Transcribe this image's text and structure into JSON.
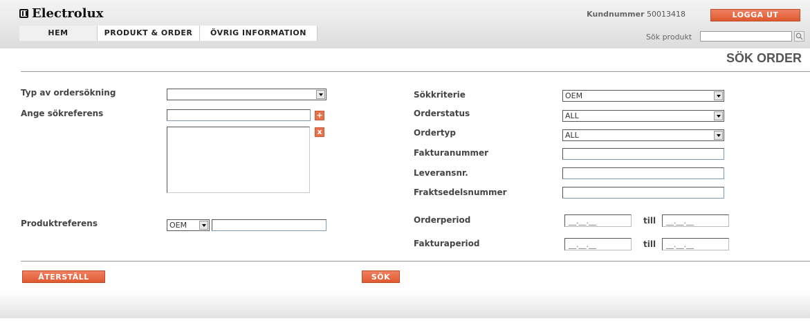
{
  "brand": {
    "name": "Electrolux"
  },
  "header": {
    "kund_label": "Kundnummer",
    "kund_value": "50013418",
    "logout_label": "LOGGA UT",
    "search_label": "Sök produkt",
    "search_value": ""
  },
  "nav": {
    "items": [
      {
        "label": "HEM"
      },
      {
        "label": "PRODUKT & ORDER"
      },
      {
        "label": "ÖVRIG INFORMATION"
      }
    ]
  },
  "page": {
    "title": "SÖK ORDER"
  },
  "left": {
    "typ_label": "Typ av ordersökning",
    "typ_value": "",
    "ange_label": "Ange sökreferens",
    "ange_value": "",
    "add_icon": "+",
    "remove_icon": "x",
    "produkt_label": "Produktreferens",
    "produkt_select_value": "OEM",
    "produkt_input_value": ""
  },
  "right": {
    "sokkriterie_label": "Sökkriterie",
    "sokkriterie_value": "OEM",
    "orderstatus_label": "Orderstatus",
    "orderstatus_value": "ALL",
    "ordertyp_label": "Ordertyp",
    "ordertyp_value": "ALL",
    "faktura_label": "Fakturanummer",
    "faktura_value": "",
    "leverans_label": "Leveransnr.",
    "leverans_value": "",
    "frakt_label": "Fraktsedelsnummer",
    "frakt_value": "",
    "orderperiod_label": "Orderperiod",
    "fakturaperiod_label": "Fakturaperiod",
    "till_label": "till",
    "date_placeholder": "__.__.__"
  },
  "actions": {
    "reset_label": "ÅTERSTÄLL",
    "search_label": "SÖK"
  },
  "colors": {
    "accent": "#e8704a",
    "header_bg": "#e4e4e4",
    "title": "#555555"
  }
}
